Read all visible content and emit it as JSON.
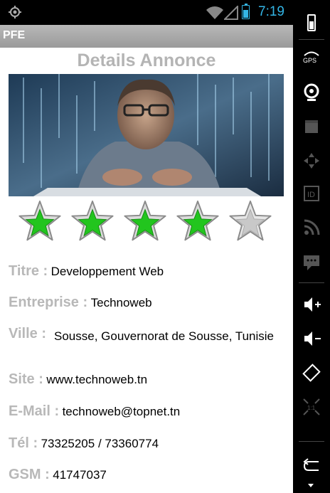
{
  "status": {
    "time": "7:19"
  },
  "app": {
    "title": "PFE"
  },
  "page": {
    "heading": "Details Annonce"
  },
  "rating": {
    "value": 4,
    "max": 5
  },
  "fields": {
    "titre": {
      "label": "Titre :",
      "value": "Developpement Web"
    },
    "entreprise": {
      "label": "Entreprise :",
      "value": "Technoweb"
    },
    "ville": {
      "label": "Ville :",
      "value": "Sousse, Gouvernorat de Sousse, Tunisie"
    },
    "site": {
      "label": "Site :",
      "value": "www.technoweb.tn"
    },
    "email": {
      "label": "E-Mail :",
      "value": "technoweb@topnet.tn"
    },
    "tel": {
      "label": "Tél :",
      "value": "73325205 / 73360774"
    },
    "gsm": {
      "label": "GSM :",
      "value": "41747037"
    }
  },
  "colors": {
    "accent": "#33b5e5",
    "star_on": "#22c51e",
    "star_off": "#c8c8c8",
    "label": "#b8b8b8"
  },
  "sidebar_icons": [
    "battery-icon",
    "gps-icon",
    "webcam-icon",
    "camera-icon",
    "dpad-icon",
    "id-icon",
    "rss-icon",
    "message-icon",
    "volume-up-icon",
    "volume-down-icon",
    "rotate-icon",
    "scale-icon",
    "back-icon"
  ]
}
